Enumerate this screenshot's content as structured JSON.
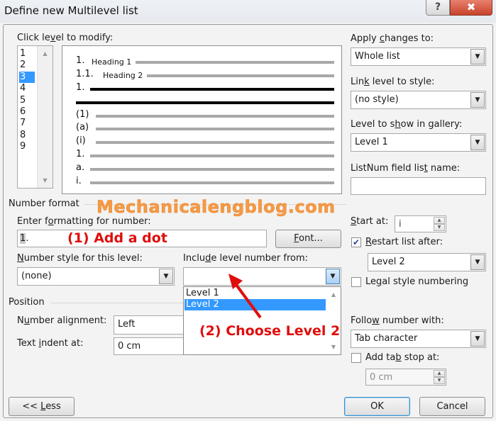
{
  "window": {
    "title": "Define new Multilevel list",
    "help_icon": "?",
    "close_icon": "✖"
  },
  "level_picker": {
    "label_pre": "Click le",
    "label_u": "v",
    "label_post": "el to modify:",
    "levels": [
      "1",
      "2",
      "3",
      "4",
      "5",
      "6",
      "7",
      "8",
      "9"
    ],
    "selected_index": 2
  },
  "preview": {
    "rows": [
      {
        "num": "1.",
        "text": "Heading 1",
        "style": "gray"
      },
      {
        "num": "1.1.",
        "text": "Heading 2",
        "style": "gray"
      },
      {
        "num": "1.",
        "text": "",
        "style": "bold"
      },
      {
        "num": "",
        "text": "",
        "style": "bold"
      },
      {
        "num": "(1)",
        "text": "",
        "style": "gray"
      },
      {
        "num": "(a)",
        "text": "",
        "style": "gray"
      },
      {
        "num": "(i)",
        "text": "",
        "style": "gray"
      },
      {
        "num": "1.",
        "text": "",
        "style": "gray"
      },
      {
        "num": "a.",
        "text": "",
        "style": "gray"
      },
      {
        "num": "i.",
        "text": "",
        "style": "gray"
      }
    ]
  },
  "apply_changes": {
    "label_pre": "Apply ",
    "label_u": "c",
    "label_post": "hanges to:",
    "value": "Whole list"
  },
  "link_level": {
    "label_pre": "Lin",
    "label_u": "k",
    "label_post": " level to style:",
    "value": "(no style)"
  },
  "gallery_level": {
    "label_pre": "Level to s",
    "label_u": "h",
    "label_post": "ow in gallery:",
    "value": "Level 1"
  },
  "listnum": {
    "label_pre": "ListNum field lis",
    "label_u": "t",
    "label_post": " name:",
    "value": ""
  },
  "number_format": {
    "section_title": "Number format",
    "enter_label_pre": "Enter f",
    "enter_label_u": "o",
    "enter_label_post": "rmatting for number:",
    "format_highlight": "1",
    "format_rest": ".",
    "font_button_u": "F",
    "font_button_rest": "ont...",
    "number_style_label_pre": "",
    "number_style_label_u": "N",
    "number_style_label_post": "umber style for this level:",
    "number_style_value": "(none)",
    "include_label_pre": "Inclu",
    "include_label_u": "d",
    "include_label_post": "e level number from:",
    "include_value": "",
    "include_options": [
      "Level 1",
      "Level 2"
    ],
    "include_selected_index": 1
  },
  "start": {
    "label_u": "S",
    "label_post": "tart at:",
    "value": "i",
    "restart_checked": true,
    "restart_label_u": "R",
    "restart_label_post": "estart list after:",
    "restart_value": "Level 2",
    "legal_checked": false,
    "legal_label_pre": "Le",
    "legal_label_u": "g",
    "legal_label_post": "al style numbering"
  },
  "position": {
    "section_title": "Position",
    "alignment_label_pre": "N",
    "alignment_label_u": "u",
    "alignment_label_post": "mber alignment:",
    "alignment_value": "Left",
    "indent_label_pre": "Text ",
    "indent_label_u": "i",
    "indent_label_post": "ndent at:",
    "indent_value": "0 cm",
    "follow_label_pre": "Follo",
    "follow_label_u": "w",
    "follow_label_post": " number with:",
    "follow_value": "Tab character",
    "tabstop_checked": false,
    "tabstop_label_pre": "Add ta",
    "tabstop_label_u": "b",
    "tabstop_label_post": " stop at:",
    "tabstop_value": "0 cm"
  },
  "buttons": {
    "less_pre": "<< ",
    "less_u": "L",
    "less_post": "ess",
    "ok": "OK",
    "cancel": "Cancel"
  },
  "overlay": {
    "watermark": "Mechanicalengblog.com",
    "annotation_1": "(1) Add a dot",
    "annotation_2": "(2) Choose Level 2",
    "annotation_color": "#e00d0d",
    "watermark_color": "#f59a45"
  }
}
